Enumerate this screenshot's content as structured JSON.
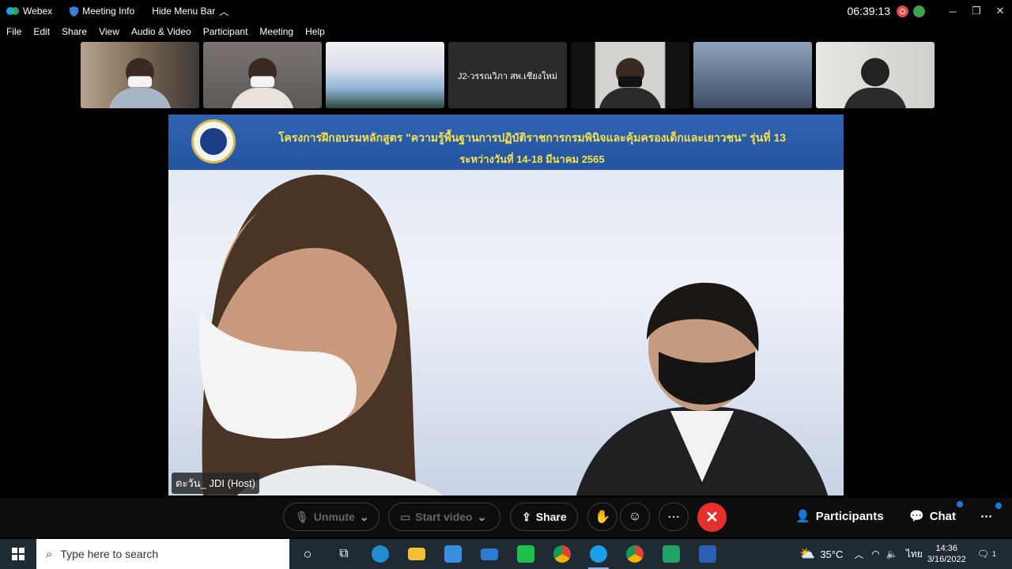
{
  "titlebar": {
    "app_name": "Webex",
    "meeting_info": "Meeting Info",
    "hide_menu": "Hide Menu Bar",
    "time": "06:39:13"
  },
  "menu": [
    "File",
    "Edit",
    "Share",
    "View",
    "Audio & Video",
    "Participant",
    "Meeting",
    "Help"
  ],
  "thumbnails": [
    {
      "kind": "video",
      "bg": "#8a7664"
    },
    {
      "kind": "video",
      "bg": "#6f6a66"
    },
    {
      "kind": "video",
      "bg": "#c9cfe0"
    },
    {
      "kind": "label",
      "label": "J2-วรรณวิภา สพ.เชียงใหม่",
      "bg": "#2b2b2b"
    },
    {
      "kind": "video",
      "bg": "#c8c8c4"
    },
    {
      "kind": "video",
      "bg": "#4d5f77"
    },
    {
      "kind": "video",
      "bg": "#dadad6"
    }
  ],
  "main": {
    "banner_title": "โครงการฝึกอบรมหลักสูตร \"ความรู้พื้นฐานการปฏิบัติราชการกรมพินิจและคุ้มครองเด็กและเยาวชน\" รุ่นที่ 13",
    "banner_subtitle": "ระหว่างวันที่ 14-18 มีนาคม 2565",
    "name_tag": "ตะวัน_ JDI (Host)"
  },
  "controls": {
    "unmute": "Unmute",
    "start_video": "Start video",
    "share": "Share",
    "participants": "Participants",
    "chat": "Chat"
  },
  "taskbar": {
    "search_placeholder": "Type here to search",
    "temperature": "35°C",
    "language": "ไทย",
    "time": "14:36",
    "date": "3/16/2022",
    "notification_count": "1"
  }
}
